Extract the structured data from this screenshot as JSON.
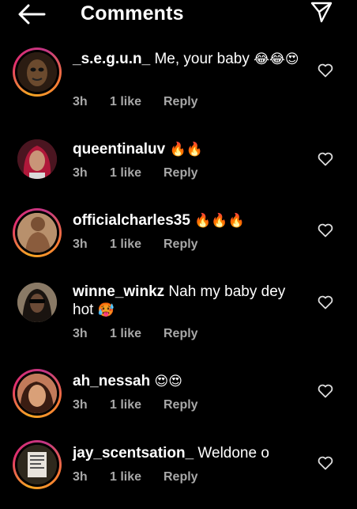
{
  "header": {
    "title": "Comments",
    "back_icon": "arrow-left-icon",
    "send_icon": "paper-plane-icon"
  },
  "colors": {
    "background": "#000000",
    "text": "#ffffff",
    "meta": "#a8a8a8",
    "story_ring": "#e1306c"
  },
  "comments": [
    {
      "username": "_s.e.g.u.n_",
      "text": " Me, your baby ",
      "emoji": "😂😂😍",
      "time": "3h",
      "likes": "1 like",
      "reply": "Reply"
    },
    {
      "username": "queentinaluv",
      "text": " ",
      "emoji": "🔥🔥",
      "time": "3h",
      "likes": "1 like",
      "reply": "Reply"
    },
    {
      "username": "officialcharles35",
      "text": " ",
      "emoji": "🔥🔥🔥",
      "time": "3h",
      "likes": "1 like",
      "reply": "Reply"
    },
    {
      "username": "winne_winkz",
      "text": " Nah my baby dey hot ",
      "emoji": "🥵",
      "time": "3h",
      "likes": "1 like",
      "reply": "Reply"
    },
    {
      "username": "ah_nessah",
      "text": " ",
      "emoji": "😍😍",
      "time": "3h",
      "likes": "1 like",
      "reply": "Reply"
    },
    {
      "username": "jay_scentsation_",
      "text": " Weldone o",
      "emoji": "",
      "time": "3h",
      "likes": "1 like",
      "reply": "Reply"
    }
  ]
}
